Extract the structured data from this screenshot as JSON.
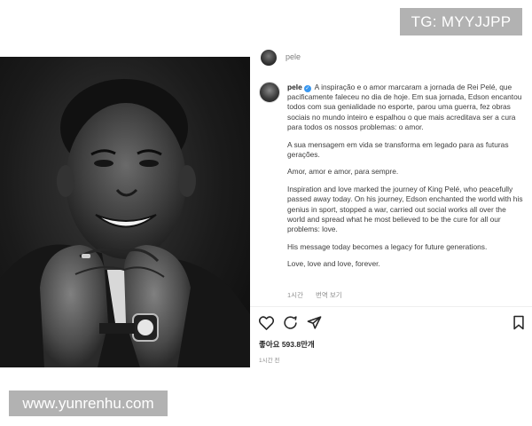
{
  "watermarks": {
    "top": "TG: MYYJJPP",
    "bottom": "www.yunrenhu.com"
  },
  "post": {
    "username": "pele",
    "verified_icon": "verified-badge-icon",
    "caption": [
      "A inspiração e o amor marcaram a jornada de Rei Pelé, que pacificamente faleceu no dia de hoje. Em sua jornada, Edson encantou todos com sua genialidade no esporte, parou uma guerra, fez obras sociais no mundo inteiro e espalhou o que mais acreditava ser a cura para todos os nossos problemas: o amor.",
      "A sua mensagem em vida se transforma em legado para as futuras gerações.",
      "Amor, amor e amor, para sempre.",
      "Inspiration and love marked the journey of King Pelé, who peacefully passed away today. On his journey, Edson enchanted the world with his genius in sport, stopped a war, carried out social works all over the world and spread what he most believed to be the cure for all our problems: love.",
      "His message today becomes a legacy for future generations.",
      "Love, love and love, forever."
    ],
    "caption_time": "1시간",
    "translate_label": "번역 보기",
    "likes": "좋아요 593.8만개",
    "timestamp": "1시간 전"
  },
  "icons": {
    "like": "heart-icon",
    "comment": "comment-icon",
    "share": "send-icon",
    "save": "bookmark-icon"
  },
  "colors": {
    "verified": "#3897f0",
    "watermark_bg": "#b2b2b2",
    "photo_bg": "#1b1b1b"
  }
}
